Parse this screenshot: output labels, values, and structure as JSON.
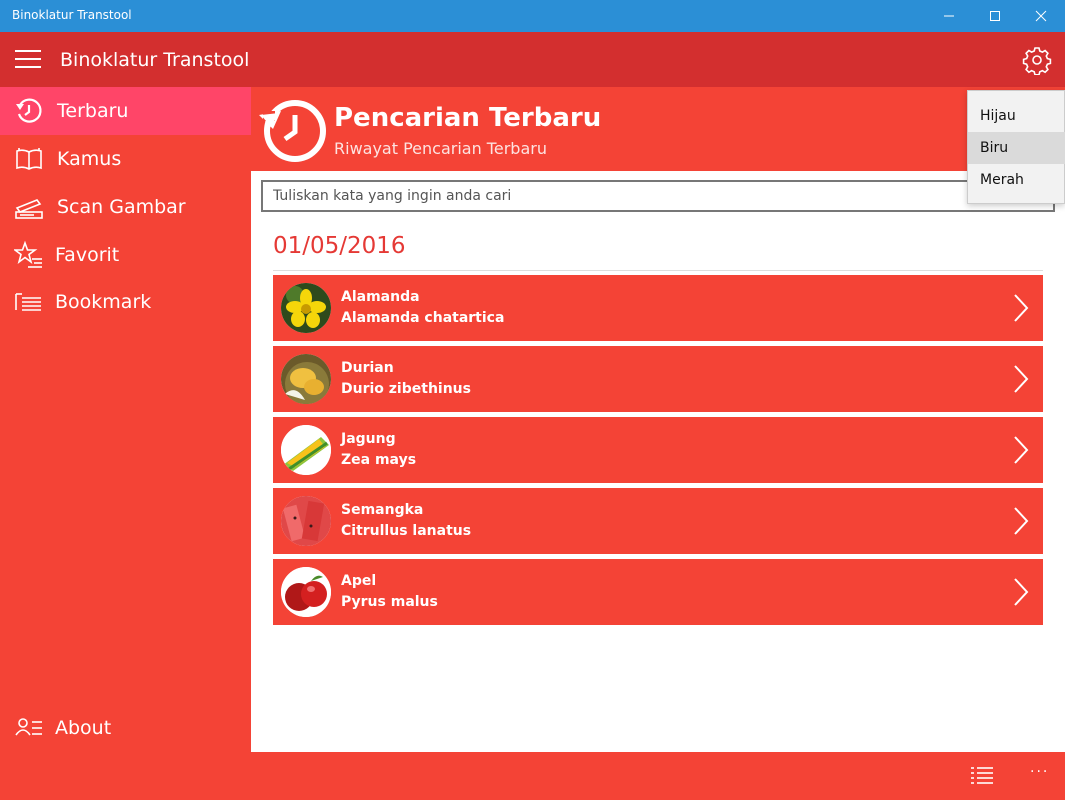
{
  "window": {
    "title": "Binoklatur Transtool"
  },
  "appbar": {
    "title": "Binoklatur Transtool"
  },
  "sidebar": {
    "items": [
      {
        "label": "Terbaru"
      },
      {
        "label": "Kamus"
      },
      {
        "label": "Scan Gambar"
      },
      {
        "label": "Favorit"
      },
      {
        "label": "Bookmark"
      }
    ],
    "about": "About"
  },
  "header": {
    "title": "Pencarian Terbaru",
    "subtitle": "Riwayat Pencarian Terbaru"
  },
  "search": {
    "placeholder": "Tuliskan kata yang ingin anda cari"
  },
  "date": "01/05/2016",
  "results": [
    {
      "name": "Alamanda",
      "scientific": "Alamanda chatartica"
    },
    {
      "name": "Durian",
      "scientific": "Durio zibethinus"
    },
    {
      "name": "Jagung",
      "scientific": "Zea mays"
    },
    {
      "name": "Semangka",
      "scientific": "Citrullus lanatus"
    },
    {
      "name": "Apel",
      "scientific": "Pyrus malus"
    }
  ],
  "theme_menu": {
    "items": [
      "Hijau",
      "Biru",
      "Merah"
    ]
  },
  "bottombar": {
    "more": "···"
  },
  "colors": {
    "titlebar": "#2b8fd6",
    "appbar": "#d32f2f",
    "primary": "#f44336",
    "active": "#ff4568"
  }
}
